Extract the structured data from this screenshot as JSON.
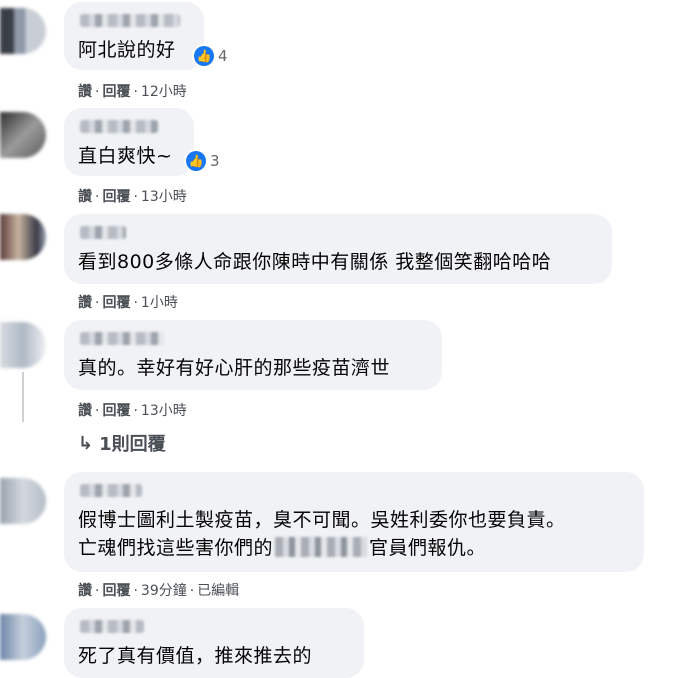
{
  "comments": [
    {
      "text": "阿北說的好",
      "likes": "4",
      "actions": {
        "like": "讚",
        "reply": "回覆",
        "time": "12小時"
      }
    },
    {
      "text": "直白爽快~",
      "likes": "3",
      "actions": {
        "like": "讚",
        "reply": "回覆",
        "time": "13小時"
      }
    },
    {
      "text": "看到800多條人命跟你陳時中有關係 我整個笑翻哈哈哈",
      "actions": {
        "like": "讚",
        "reply": "回覆",
        "time": "1小時"
      }
    },
    {
      "text": "真的。幸好有好心肝的那些疫苗濟世",
      "actions": {
        "like": "讚",
        "reply": "回覆",
        "time": "13小時"
      },
      "replies_link": "1則回覆"
    },
    {
      "text_line1": "假博士圖利土製疫苗，臭不可聞。吳姓利委你也要負責。",
      "text_line2_a": "亡魂們找這些害你們的",
      "text_line2_b": "官員們報仇。",
      "actions": {
        "like": "讚",
        "reply": "回覆",
        "time": "39分鐘",
        "edited": "已編輯"
      }
    },
    {
      "text": "死了真有價值，推來推去的"
    }
  ],
  "icons": {
    "like": "thumbs-up-icon",
    "reply_arrow": "reply-arrow-icon"
  },
  "colors": {
    "like_blue": "#1877f2",
    "bubble_bg": "#f0f2f5",
    "meta_text": "#4b4f56"
  }
}
